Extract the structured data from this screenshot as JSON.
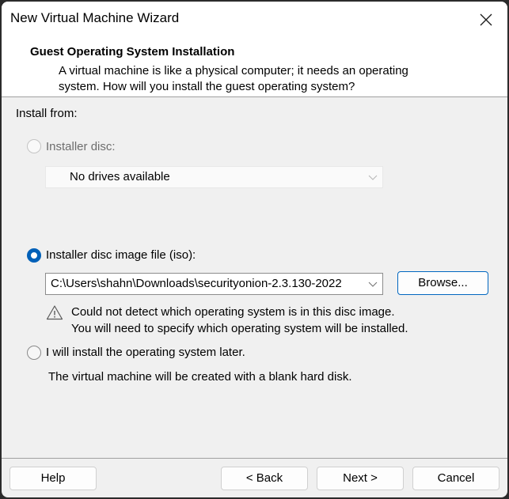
{
  "window": {
    "title": "New Virtual Machine Wizard",
    "close_icon": "close-icon"
  },
  "header": {
    "title": "Guest Operating System Installation",
    "description_line1": "A virtual machine is like a physical computer; it needs an operating",
    "description_line2": "system. How will you install the guest operating system?"
  },
  "body": {
    "install_from_label": "Install from:",
    "options": [
      {
        "label": "Installer disc:",
        "selected": false,
        "enabled": false,
        "dropdown_value": "No drives available"
      },
      {
        "label": "Installer disc image file (iso):",
        "selected": true,
        "enabled": true,
        "dropdown_value": "C:\\Users\\shahn\\Downloads\\securityonion-2.3.130-2022",
        "browse_label": "Browse...",
        "warning_icon": "warning-icon",
        "warning_line1": "Could not detect which operating system is in this disc image.",
        "warning_line2": "You will need to specify which operating system will be installed."
      },
      {
        "label": "I will install the operating system later.",
        "selected": false,
        "enabled": true,
        "note": "The virtual machine will be created with a blank hard disk."
      }
    ]
  },
  "footer": {
    "help_label": "Help",
    "back_label": "< Back",
    "next_label": "Next >",
    "cancel_label": "Cancel"
  },
  "colors": {
    "accent": "#0060b8",
    "dialog_bg": "#f0f0f0",
    "header_bg": "#ffffff"
  }
}
